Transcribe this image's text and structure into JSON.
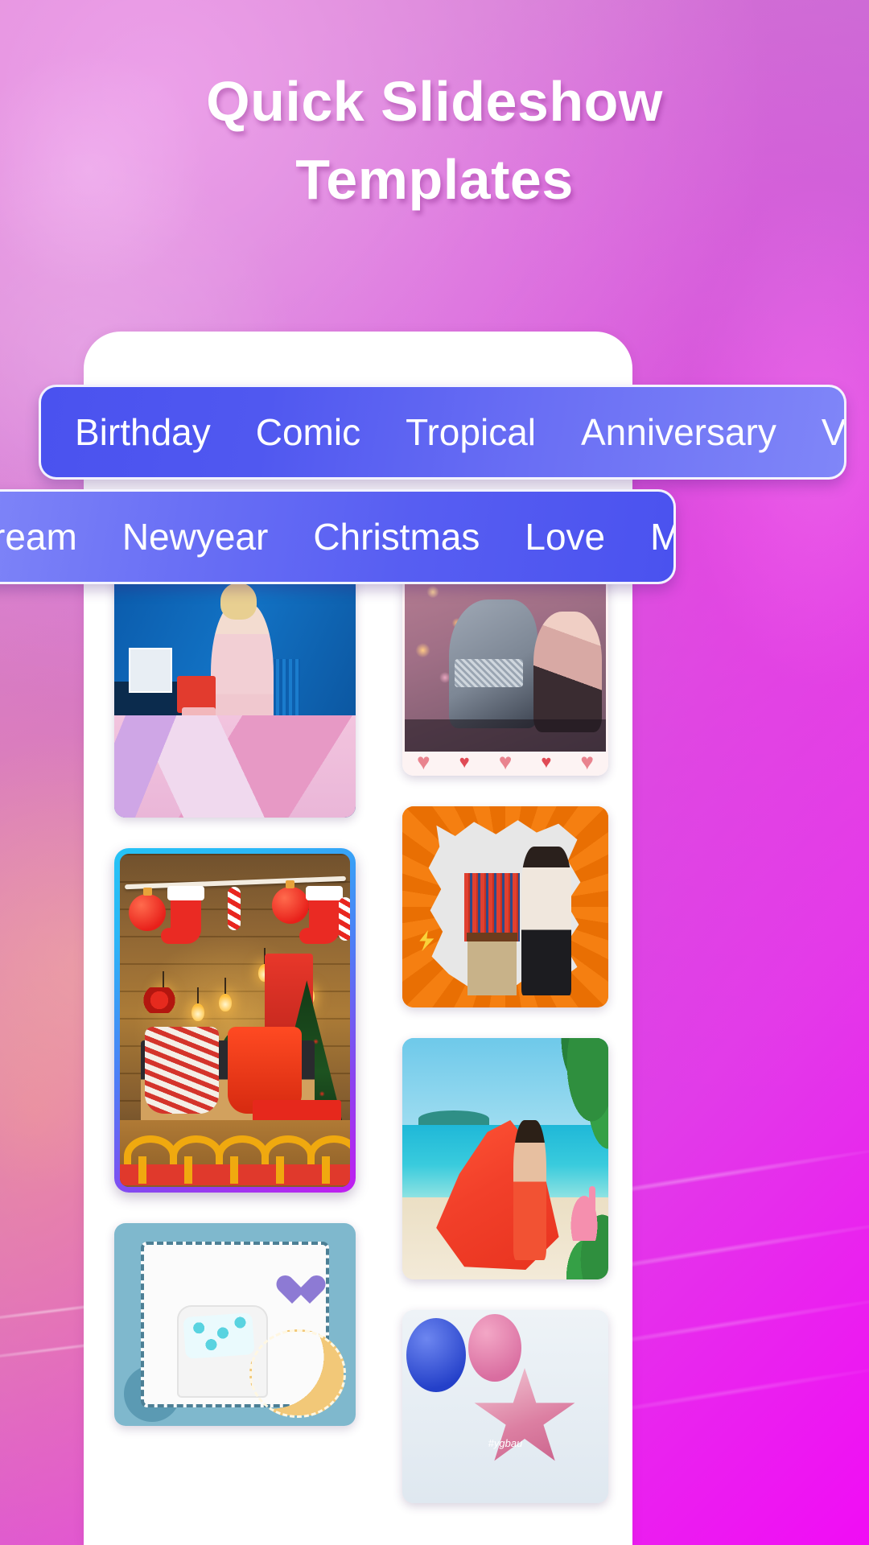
{
  "header": {
    "title_line1": "Quick Slideshow",
    "title_line2": "Templates"
  },
  "tab_rows": [
    {
      "id": "tab-row-1",
      "tabs": [
        "Birthday",
        "Comic",
        "Tropical",
        "Anniversary",
        "Vale"
      ]
    },
    {
      "id": "tab-row-2",
      "tabs": [
        "ream",
        "Newyear",
        "Christmas",
        "Love",
        "Magazine"
      ]
    }
  ],
  "templates": {
    "left_column": [
      {
        "name": "magazine-template",
        "art": "t-magazine",
        "selected": false
      },
      {
        "name": "christmas-template",
        "art": "t-xmas",
        "selected": true
      },
      {
        "name": "anniversary-template",
        "art": "t-anni",
        "selected": false
      }
    ],
    "right_column": [
      {
        "name": "love-template",
        "art": "t-love",
        "selected": false
      },
      {
        "name": "comic-template",
        "art": "t-comic",
        "selected": false
      },
      {
        "name": "tropical-template",
        "art": "t-trop",
        "selected": false
      },
      {
        "name": "birthday-template",
        "art": "t-bday",
        "selected": false
      }
    ]
  },
  "art_labels": {
    "birthday_tag": "#ygbau"
  },
  "colors": {
    "background_start": "#d97fd0",
    "background_end": "#f10cf5",
    "sheet": "#ffffff",
    "tab_blue_dark": "#4a52ef",
    "tab_blue_light": "#8086f8",
    "tab_text": "#ffffff",
    "selected_border_start": "#25c3f5",
    "selected_border_end": "#c21df0",
    "title_text": "#ffffff"
  }
}
